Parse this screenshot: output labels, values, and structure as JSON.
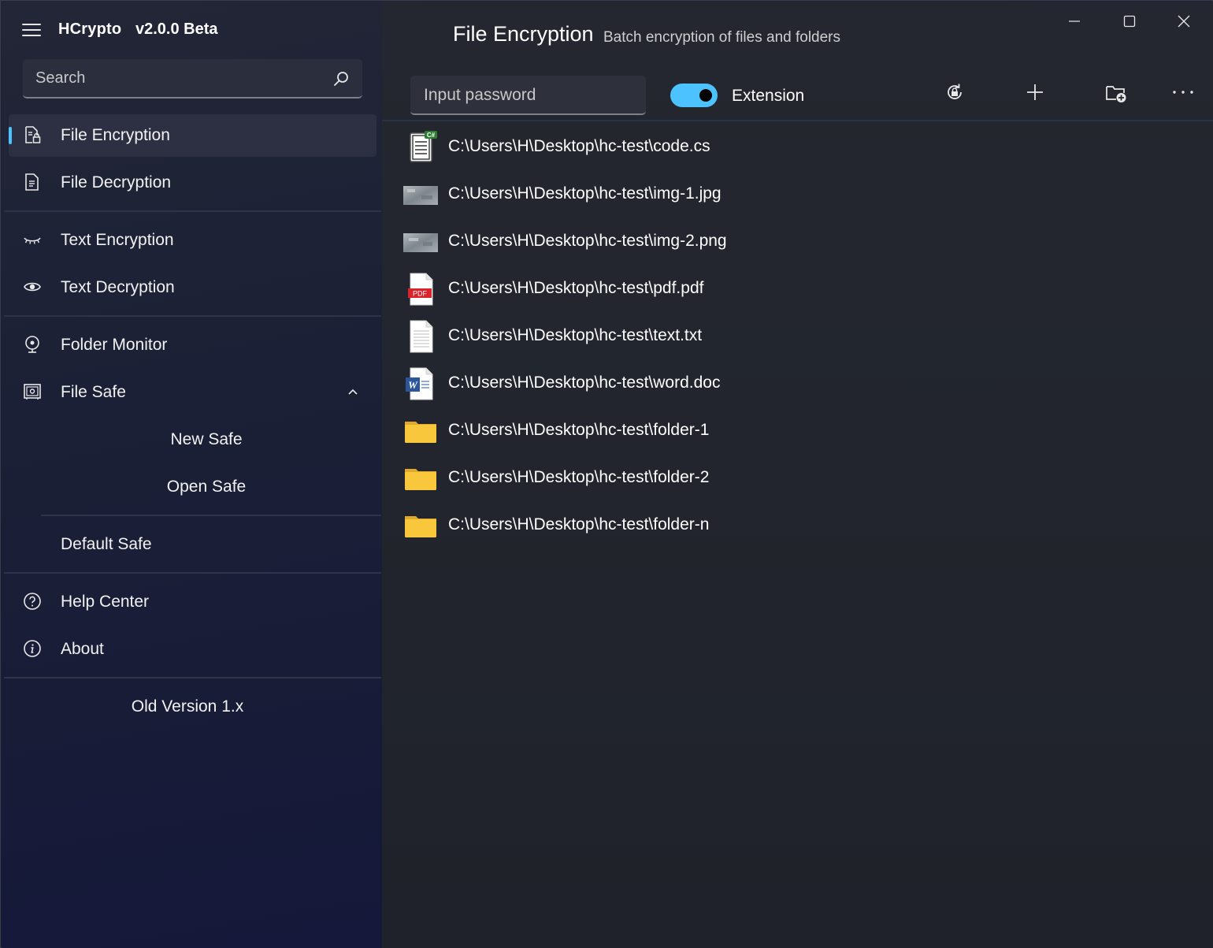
{
  "app": {
    "name": "HCrypto",
    "version": "v2.0.0 Beta"
  },
  "search": {
    "placeholder": "Search"
  },
  "sidebar": {
    "items": [
      {
        "label": "File Encryption",
        "icon": "file-lock-icon",
        "selected": true
      },
      {
        "label": "File Decryption",
        "icon": "document-icon",
        "selected": false
      },
      {
        "label": "Text Encryption",
        "icon": "eye-closed-icon",
        "selected": false
      },
      {
        "label": "Text Decryption",
        "icon": "eye-icon",
        "selected": false
      },
      {
        "label": "Folder Monitor",
        "icon": "webcam-icon",
        "selected": false
      },
      {
        "label": "File Safe",
        "icon": "safe-icon",
        "selected": false,
        "expanded": true
      }
    ],
    "file_safe_children": [
      {
        "label": "New Safe"
      },
      {
        "label": "Open Safe"
      }
    ],
    "default_safe": "Default Safe",
    "help_items": [
      {
        "label": "Help Center",
        "icon": "question-icon"
      },
      {
        "label": "About",
        "icon": "info-icon"
      }
    ],
    "old_version": "Old Version 1.x"
  },
  "main": {
    "title": "File Encryption",
    "subtitle": "Batch encryption of files and folders",
    "password_placeholder": "Input password",
    "extension_toggle": {
      "label": "Extension",
      "on": true
    },
    "toolbar_icons": [
      "lock-refresh-icon",
      "plus-icon",
      "folder-add-icon",
      "more-icon"
    ]
  },
  "files": [
    {
      "path": "C:\\Users\\H\\Desktop\\hc-test\\code.cs",
      "type": "csharp"
    },
    {
      "path": "C:\\Users\\H\\Desktop\\hc-test\\img-1.jpg",
      "type": "image"
    },
    {
      "path": "C:\\Users\\H\\Desktop\\hc-test\\img-2.png",
      "type": "image"
    },
    {
      "path": "C:\\Users\\H\\Desktop\\hc-test\\pdf.pdf",
      "type": "pdf"
    },
    {
      "path": "C:\\Users\\H\\Desktop\\hc-test\\text.txt",
      "type": "text"
    },
    {
      "path": "C:\\Users\\H\\Desktop\\hc-test\\word.doc",
      "type": "word"
    },
    {
      "path": "C:\\Users\\H\\Desktop\\hc-test\\folder-1",
      "type": "folder"
    },
    {
      "path": "C:\\Users\\H\\Desktop\\hc-test\\folder-2",
      "type": "folder"
    },
    {
      "path": "C:\\Users\\H\\Desktop\\hc-test\\folder-n",
      "type": "folder"
    }
  ],
  "icon_labels": {
    "csharp_badge": "C#",
    "pdf_badge": "PDF",
    "word_badge": "W"
  },
  "colors": {
    "accent": "#4cc2ff",
    "folder": "#f8c73b",
    "pdf_red": "#d9242b",
    "word_blue": "#2b579a"
  }
}
